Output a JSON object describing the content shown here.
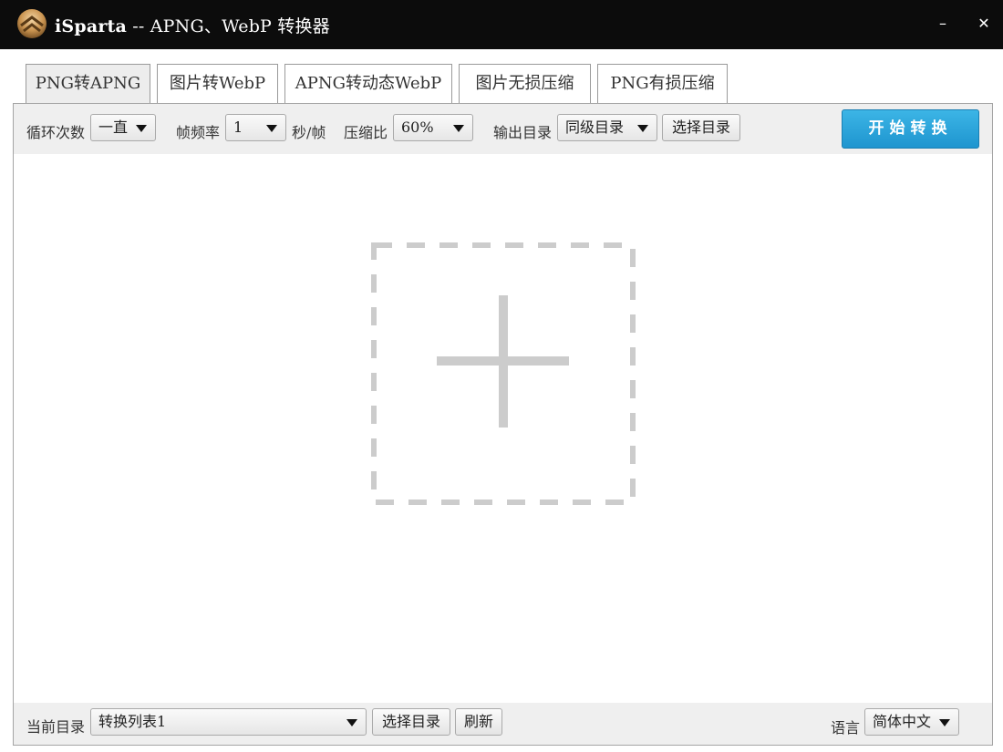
{
  "window": {
    "app_name": "iSparta",
    "title_rest": " -- APNG、WebP 转换器",
    "minimize_glyph": "–",
    "close_glyph": "✕"
  },
  "tabs": [
    {
      "label": "PNG转APNG",
      "active": true
    },
    {
      "label": "图片转WebP",
      "active": false
    },
    {
      "label": "APNG转动态WebP",
      "active": false
    },
    {
      "label": "图片无损压缩",
      "active": false
    },
    {
      "label": "PNG有损压缩",
      "active": false
    }
  ],
  "toolbar": {
    "loop_label": "循环次数",
    "loop_value": "一直",
    "fps_label": "帧频率",
    "fps_value": "1",
    "fps_unit": "秒/帧",
    "compress_label": "压缩比",
    "compress_value": "60%",
    "output_label": "输出目录",
    "output_value": "同级目录",
    "choose_dir_label": "选择目录",
    "start_label": "开始转换"
  },
  "dropzone": {
    "icon": "add-plus-icon"
  },
  "footer": {
    "current_dir_label": "当前目录",
    "current_dir_value": "转换列表1",
    "choose_dir_label": "选择目录",
    "refresh_label": "刷新",
    "language_label": "语言",
    "language_value": "简体中文"
  },
  "colors": {
    "titlebar": "#0c0c0c",
    "accent": "#2aa4dc",
    "toolbar_bg": "#efefef",
    "dropzone_stroke": "#cccccc"
  }
}
